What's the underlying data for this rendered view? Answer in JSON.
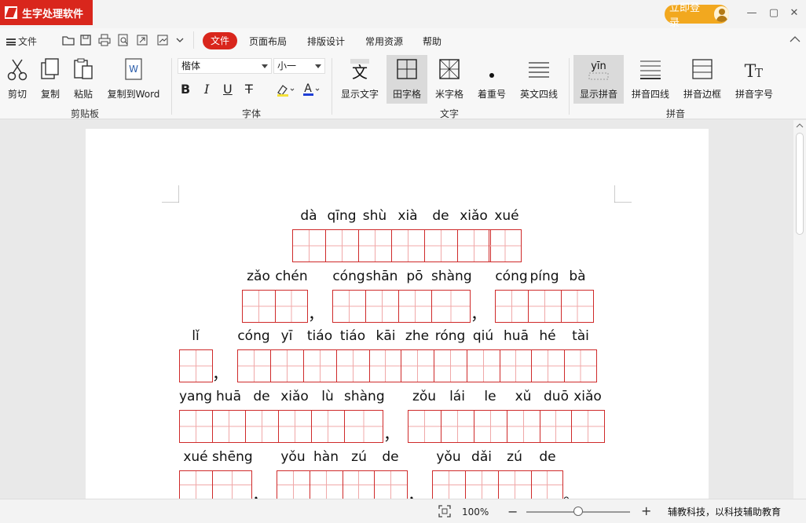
{
  "app": {
    "title": "生字处理软件",
    "login": "立即登录"
  },
  "menu": {
    "file": "文件",
    "tabs": [
      "文件",
      "页面布局",
      "排版设计",
      "常用资源",
      "帮助"
    ]
  },
  "ribbon": {
    "clipboard": {
      "group": "剪贴板",
      "cut": "剪切",
      "copy": "复制",
      "paste": "粘贴",
      "copy_word": "复制到Word"
    },
    "font": {
      "group": "字体",
      "family": "楷体",
      "size": "小一"
    },
    "text": {
      "group": "文字",
      "show_text": "显示文字",
      "tian": "田字格",
      "mi": "米字格",
      "emphasis": "着重号",
      "four_lines": "英文四线"
    },
    "pinyin": {
      "group": "拼音",
      "show_pinyin": "显示拼音",
      "pinyin_four": "拼音四线",
      "pinyin_border": "拼音边框",
      "pinyin_size": "拼音字号",
      "sample": "yīn"
    }
  },
  "document": {
    "rows": [
      {
        "syllables": [
          "dà",
          "qīng",
          "shù",
          "xià",
          "de",
          "xiǎo",
          "xué"
        ]
      },
      {
        "syllables": [
          "zǎo",
          "chén",
          "cóng",
          "shān",
          "pō",
          "shàng",
          "cóng",
          "píng",
          "bà"
        ]
      },
      {
        "syllables": [
          "lǐ",
          "cóng",
          "yī",
          "tiáo",
          "tiáo",
          "kāi",
          "zhe",
          "róng",
          "qiú",
          "huā",
          "hé",
          "tài"
        ]
      },
      {
        "syllables": [
          "yang",
          "huā",
          "de",
          "xiǎo",
          "lù",
          "shàng",
          "zǒu",
          "lái",
          "le",
          "xǔ",
          "duō",
          "xiǎo"
        ]
      },
      {
        "syllables": [
          "xué",
          "shēng",
          "yǒu",
          "hàn",
          "zú",
          "de",
          "yǒu",
          "dǎi",
          "zú",
          "de"
        ]
      }
    ],
    "punct": {
      "comma": "，",
      "period": "。"
    }
  },
  "status": {
    "zoom": "100%",
    "slogan": "辅教科技，以科技辅助教育"
  },
  "colors": {
    "brand": "#d9261c",
    "grid": "#cf2a2a",
    "login": "#f2a81f"
  }
}
